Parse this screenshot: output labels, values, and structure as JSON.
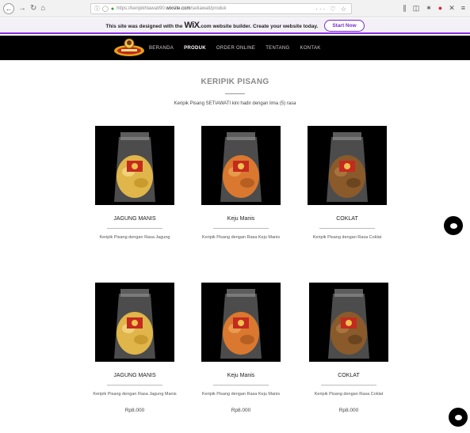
{
  "browser": {
    "url_prefix": "https://keripikhlawati90.",
    "url_domain": "wixsite.com",
    "url_path": "/setiawati/produk",
    "url_actions": "··· ♡ ☆"
  },
  "wix_banner": {
    "text_before": "This site was designed with the",
    "logo": "WiX",
    "text_after": ".com website builder. Create your website today.",
    "button": "Start Now"
  },
  "nav": {
    "items": [
      {
        "label": "BERANDA",
        "active": false
      },
      {
        "label": "PRODUK",
        "active": true
      },
      {
        "label": "ORDER ONLINE",
        "active": false
      },
      {
        "label": "TENTANG",
        "active": false
      },
      {
        "label": "KONTAK",
        "active": false
      }
    ]
  },
  "page": {
    "title": "KERIPIK PISANG",
    "subtitle": "Keripik Pisang SETIAWATI kini hadir dengan lima (5) rasa"
  },
  "row1": [
    {
      "name": "JAGUNG MANIS",
      "desc": "Keripik Pisang dengan Rasa Jagung"
    },
    {
      "name": "Keju Manis",
      "desc": "Keripik Pisang dengan Rasa Keju Manis"
    },
    {
      "name": "COKLAT",
      "desc": "Keripik Pisang dengan Rasa Coklat"
    }
  ],
  "row2": [
    {
      "name": "JAGUNG MANIS",
      "desc": "Keripik Pisang dengan Rasa Jagung Manis",
      "price": "Rp8.000"
    },
    {
      "name": "Keju Manis",
      "desc": "Keripik Pisang dengan Rasa Keju Manis",
      "price": "Rp8.000"
    },
    {
      "name": "COKLAT",
      "desc": "Keripik Pisang dengan Rasa Coklat",
      "price": "Rp8.000"
    }
  ],
  "colors": {
    "wix_accent": "#7a2ad0",
    "nav_bg": "#000000",
    "chip_jagung": "#e0b64a",
    "chip_keju": "#d9782e",
    "chip_coklat": "#8a5a2b"
  }
}
